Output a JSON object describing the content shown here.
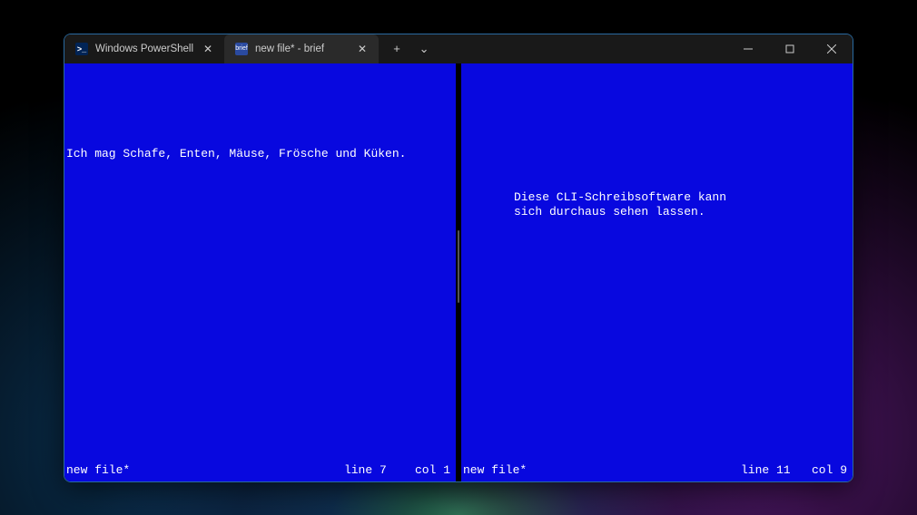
{
  "tabs": [
    {
      "label": "Windows PowerShell",
      "icon": "ps"
    },
    {
      "label": "new file* - brief",
      "icon": "brief"
    }
  ],
  "panes": {
    "left": {
      "text": "Ich mag Schafe, Enten, Mäuse, Frösche und Küken.",
      "filename": "new file*",
      "line_label": "line 7",
      "col_label": "col 1"
    },
    "right": {
      "text_line1": "Diese CLI-Schreibsoftware kann",
      "text_line2": "sich durchaus sehen lassen.",
      "filename": "new file*",
      "line_label": "line 11",
      "col_label": "col 9"
    }
  },
  "icons": {
    "ps_glyph": ">_",
    "brief_glyph": "brief",
    "plus": "+",
    "chevron": "⌄",
    "close": "✕"
  }
}
